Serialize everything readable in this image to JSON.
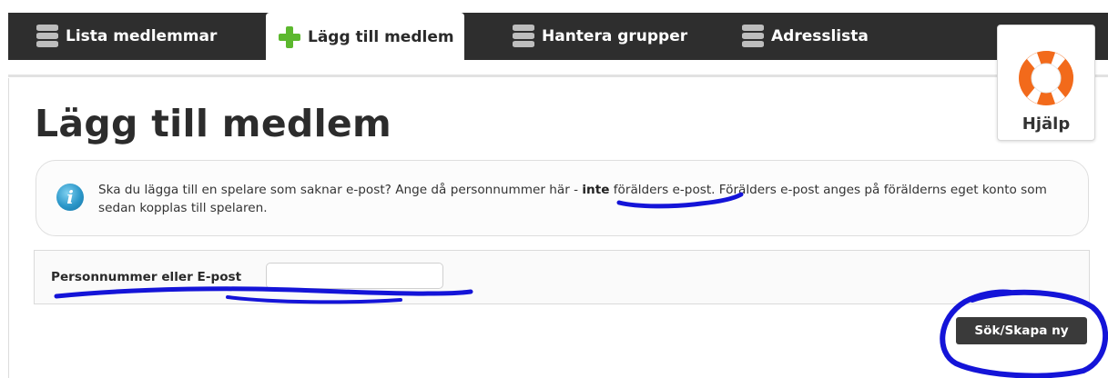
{
  "nav": {
    "tabs": [
      {
        "label": "Lista medlemmar",
        "icon": "database-icon",
        "active": false
      },
      {
        "label": "Lägg till medlem",
        "icon": "plus-icon",
        "active": true
      },
      {
        "label": "Hantera grupper",
        "icon": "database-icon",
        "active": false
      },
      {
        "label": "Adresslista",
        "icon": "database-icon",
        "active": false
      }
    ]
  },
  "help": {
    "label": "Hjälp",
    "icon": "lifebuoy-icon"
  },
  "page": {
    "title": "Lägg till medlem"
  },
  "info": {
    "icon": "info-icon",
    "text_before": "Ska du lägga till en spelare som saknar e-post? Ange då personnummer här - ",
    "bold": "inte",
    "text_after": " förälders e-post. Förälders e-post anges på förälderns eget konto som sedan kopplas till spelaren."
  },
  "form": {
    "field_label": "Personnummer eller E-post",
    "field_value": "",
    "submit_label": "Sök/Skapa ny"
  },
  "colors": {
    "navbar": "#2e2e2e",
    "accent_green": "#5cb82e",
    "annotation_blue": "#1414d8",
    "button": "#3a3a3a"
  }
}
